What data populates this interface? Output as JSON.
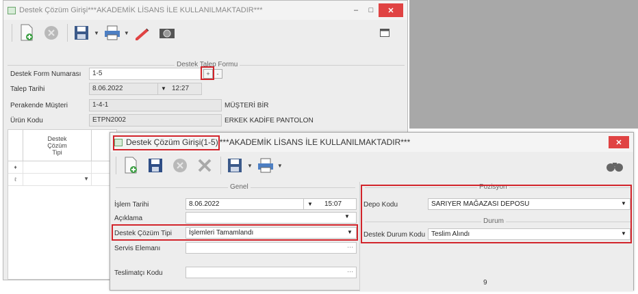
{
  "back_window": {
    "title": "Destek Çözüm Girişi***AKADEMİK LİSANS İLE KULLANILMAKTADIR***",
    "toolbar_icons": [
      "new-doc-icon",
      "cancel-icon",
      "save-icon",
      "print-icon",
      "edit-icon",
      "camera-icon"
    ],
    "group_title": "Destek Talep Formu",
    "fields": {
      "form_no_label": "Destek Form Numarası",
      "form_no_value": "1-5",
      "talep_tarihi_label": "Talep Tarihi",
      "talep_tarihi_date": "8.06.2022",
      "talep_tarihi_time": "12:27",
      "musteri_label": "Perakende Müşteri",
      "musteri_code": "1-4-1",
      "musteri_name": "MÜŞTERİ BİR",
      "urun_label": "Ürün Kodu",
      "urun_code": "ETPN2002",
      "urun_name": "ERKEK KADİFE PANTOLON"
    },
    "grid": {
      "column_header": "Destek\nÇözüm\nTipi",
      "row_markers": [
        "♦",
        "ℓ"
      ]
    },
    "window_controls": {
      "minimize": "–",
      "maximize": "□",
      "close": "✕"
    }
  },
  "front_window": {
    "title": "Destek Çözüm Girişi(1-5)",
    "title_suffix": "***AKADEMİK LİSANS İLE KULLANILMAKTADIR***",
    "close": "✕",
    "toolbar_icons": [
      "new-doc-icon",
      "save-icon",
      "cancel-icon",
      "delete-icon",
      "save-options-icon",
      "print-icon",
      "binoculars-icon"
    ],
    "genel_title": "Genel",
    "islem_tarihi_label": "İşlem Tarihi",
    "islem_tarihi_date": "8.06.2022",
    "islem_tarihi_time": "15:07",
    "aciklama_label": "Açıklama",
    "cozum_tipi_label": "Destek Çözüm Tipi",
    "cozum_tipi_value": "İşlemleri Tamamlandı",
    "servis_label": "Servis Elemanı",
    "teslimatci_label": "Teslimatçı Kodu",
    "pozisyon_title": "Pozisyon",
    "depo_label": "Depo Kodu",
    "depo_value": "SARIYER MAĞAZASI DEPOSU",
    "durum_title": "Durum",
    "durum_label": "Destek Durum Kodu",
    "durum_value": "Teslim Alındı",
    "footer_num": "9"
  },
  "colors": {
    "highlight_red": "#d2232a",
    "close_red": "#e04343",
    "desktop_grey": "#a8a8a8"
  }
}
